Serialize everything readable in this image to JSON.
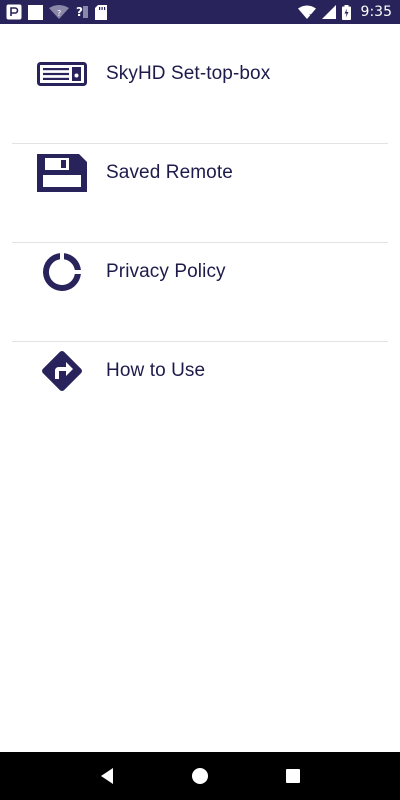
{
  "status_bar": {
    "time": "9:35",
    "background": "#28235a",
    "icons": [
      "p-app-icon",
      "square-icon",
      "wifi-unknown-icon",
      "question-icon",
      "sd-card-icon",
      "wifi-icon",
      "signal-icon",
      "battery-icon"
    ]
  },
  "menu": {
    "accent_color": "#28235a",
    "items": [
      {
        "label": "SkyHD Set-top-box",
        "icon": "set-top-box-icon"
      },
      {
        "label": "Saved Remote",
        "icon": "save-icon"
      },
      {
        "label": "Privacy Policy",
        "icon": "ring-icon"
      },
      {
        "label": "How to Use",
        "icon": "directions-icon"
      }
    ]
  },
  "nav_bar": {
    "buttons": [
      "back-icon",
      "home-icon",
      "recents-icon"
    ]
  }
}
